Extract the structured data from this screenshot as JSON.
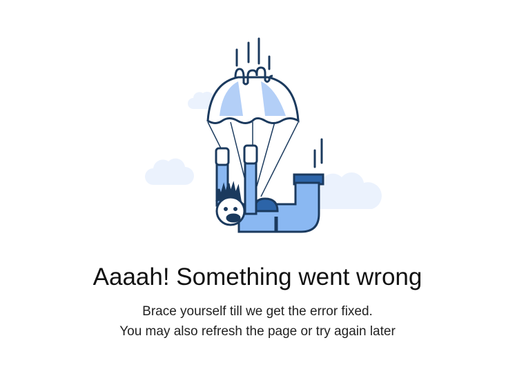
{
  "illustration": {
    "icon": "parachute-skydiver-illustration",
    "colors": {
      "outline": "#1b3a5e",
      "light": "#b3cff7",
      "mid": "#8ab8f2",
      "dark": "#2c64a8",
      "cloud": "#ebf2fd"
    }
  },
  "error": {
    "title": "Aaaah! Something went wrong",
    "line1": "Brace yourself till we get the error fixed.",
    "line2": "You may also refresh the page or try again later"
  }
}
